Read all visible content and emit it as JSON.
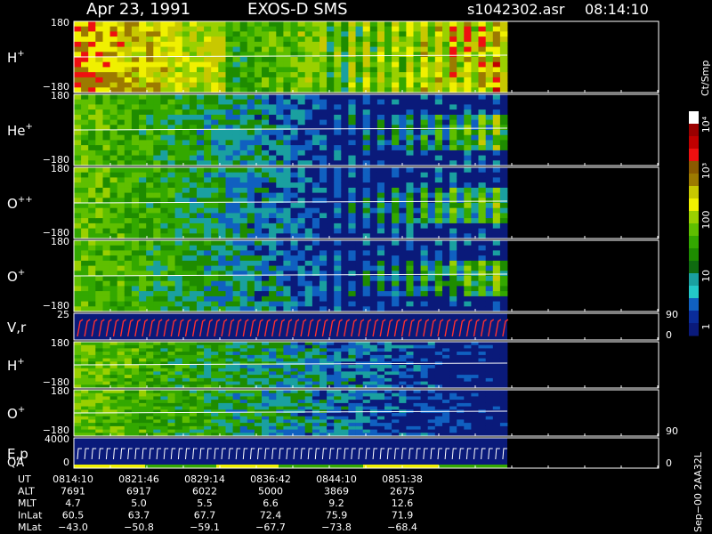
{
  "header": {
    "date": "Apr 23, 1991",
    "instrument": "EXOS-D SMS",
    "file": "s1042302.asr",
    "time": "08:14:10"
  },
  "panels": [
    {
      "label": "H",
      "sup": "+",
      "top": "180",
      "bottom": "−180"
    },
    {
      "label": "He",
      "sup": "+",
      "top": "180",
      "bottom": "−180"
    },
    {
      "label": "O",
      "sup": "++",
      "top": "180",
      "bottom": "−180"
    },
    {
      "label": "O",
      "sup": "+",
      "top": "180",
      "bottom": "−180"
    },
    {
      "label": "V,r",
      "sup": "",
      "top": "25",
      "bottom": "",
      "right_top": "90",
      "right_bottom": "0"
    },
    {
      "label": "H",
      "sup": "+",
      "top": "180",
      "bottom": "−180"
    },
    {
      "label": "O",
      "sup": "+",
      "top": "180",
      "bottom": "−180",
      "right_bottom": "90"
    },
    {
      "label": "E,p",
      "label2": "QA",
      "sup": "",
      "top": "4000",
      "bottom": "0",
      "right_bottom": "0"
    }
  ],
  "colorbar": {
    "unit": "Ct/Smp",
    "labels": [
      "10⁴",
      "10³",
      "100",
      "10",
      "1"
    ],
    "colors": [
      "#ffffff",
      "#9a0000",
      "#c00000",
      "#ee1010",
      "#8b5a00",
      "#9c7a00",
      "#c8c800",
      "#f0f000",
      "#9ad000",
      "#5fbf00",
      "#33a800",
      "#1e8c00",
      "#0f6b10",
      "#1aa0a0",
      "#23c8c8",
      "#1060c0",
      "#0a2c9a",
      "#0a1a7a"
    ]
  },
  "footer": {
    "row_labels": [
      "UT",
      "ALT",
      "MLT",
      "InLat",
      "MLat"
    ],
    "columns": [
      [
        "0814:10",
        "7691",
        "4.7",
        "60.5",
        "−43.0"
      ],
      [
        "0821:46",
        "6917",
        "5.0",
        "63.7",
        "−50.8"
      ],
      [
        "0829:14",
        "6022",
        "5.5",
        "67.7",
        "−59.1"
      ],
      [
        "0836:42",
        "5000",
        "6.6",
        "72.4",
        "−67.7"
      ],
      [
        "0844:10",
        "3869",
        "9.2",
        "75.9",
        "−73.8"
      ],
      [
        "0851:38",
        "2675",
        "12.6",
        "71.9",
        "−68.4"
      ]
    ],
    "stamp": "Sep−00 2AA32L"
  },
  "chart_data": {
    "type": "heatmap",
    "title": "Apr 23, 1991   EXOS-D SMS",
    "x_ticks": [
      "0814:10",
      "0821:46",
      "0829:14",
      "0836:42",
      "0844:10",
      "0851:38"
    ],
    "panels": [
      {
        "name": "H+",
        "ylim": [
          -180,
          180
        ]
      },
      {
        "name": "He+",
        "ylim": [
          -180,
          180
        ]
      },
      {
        "name": "O++",
        "ylim": [
          -180,
          180
        ]
      },
      {
        "name": "O+",
        "ylim": [
          -180,
          180
        ]
      },
      {
        "name": "V,r",
        "ylim": [
          0,
          25
        ],
        "right_axis": [
          0,
          90
        ]
      },
      {
        "name": "H+",
        "ylim": [
          -180,
          180
        ]
      },
      {
        "name": "O+",
        "ylim": [
          -180,
          180
        ]
      },
      {
        "name": "E,p QA",
        "ylim": [
          0,
          4000
        ]
      }
    ],
    "colorbar": {
      "label": "Ct/Smp",
      "scale": "log",
      "range": [
        1,
        10000
      ]
    }
  }
}
